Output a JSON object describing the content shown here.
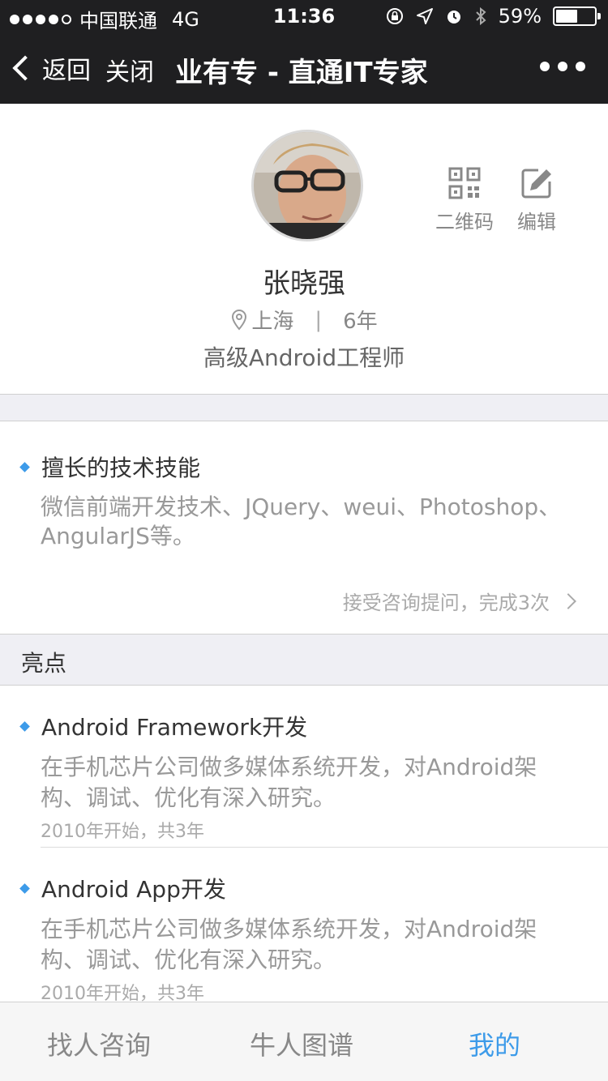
{
  "status_bar": {
    "carrier": "中国联通",
    "network": "4G",
    "time": "11:36",
    "battery": "59%",
    "battery_level": 0.59
  },
  "nav": {
    "back_label": "返回",
    "close_label": "关闭",
    "title": "业有专 - 直通IT专家"
  },
  "profile": {
    "name": "张晓强",
    "location": "上海",
    "separator": "|",
    "experience": "6年",
    "job_title": "高级Android工程师",
    "qr_label": "二维码",
    "edit_label": "编辑"
  },
  "skills": {
    "heading": "擅长的技术技能",
    "description": "微信前端开发技术、JQuery、weui、Photoshop、AngularJS等。",
    "consult_text": "接受咨询提问，完成3次"
  },
  "highlights": {
    "header": "亮点",
    "items": [
      {
        "title": "Android Framework开发",
        "description": "在手机芯片公司做多媒体系统开发，对Android架构、调试、优化有深入研究。",
        "period": "2010年开始，共3年"
      },
      {
        "title": "Android App开发",
        "description": "在手机芯片公司做多媒体系统开发，对Android架构、调试、优化有深入研究。",
        "period": "2010年开始，共3年"
      }
    ]
  },
  "tabs": {
    "items": [
      "找人咨询",
      "牛人图谱",
      "我的"
    ],
    "active": "我的"
  },
  "colors": {
    "nav_bg": "#1f1f21",
    "accent": "#3d9be9",
    "section_bg": "#efeff4"
  }
}
